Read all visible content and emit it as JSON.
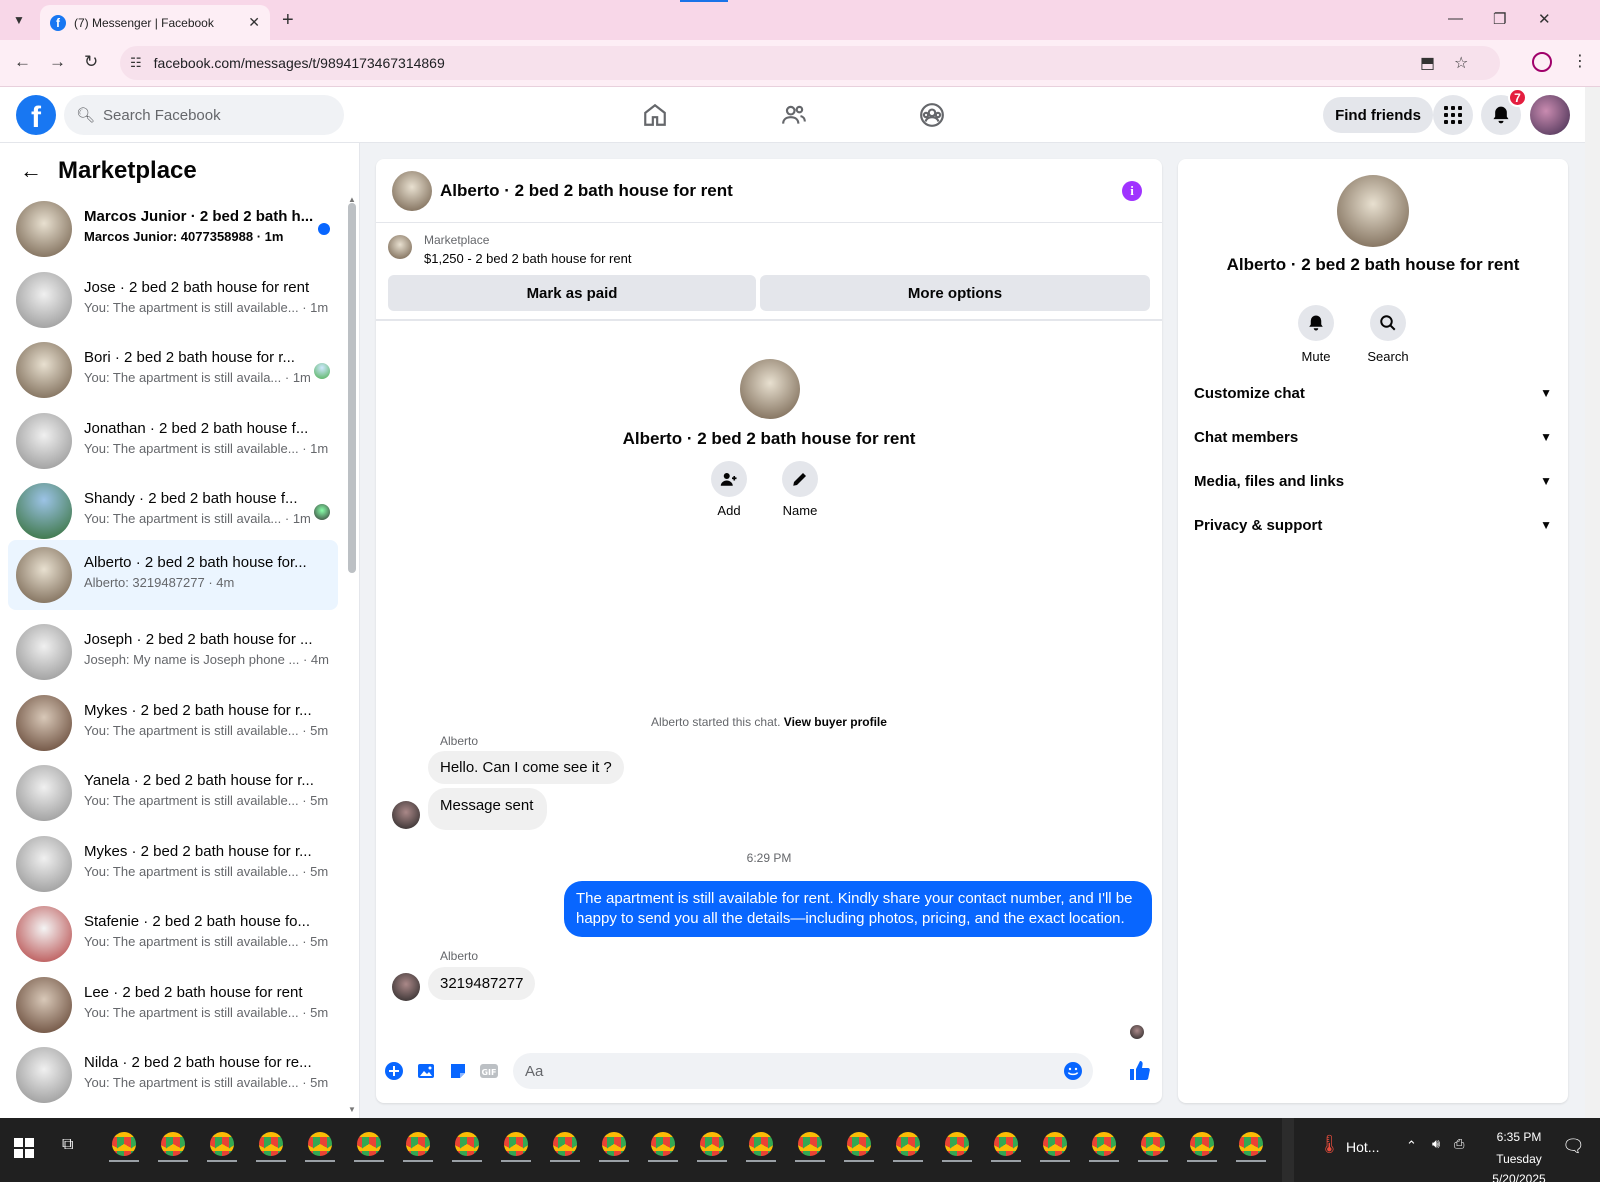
{
  "browser": {
    "tab_title": "(7) Messenger | Facebook",
    "url": "facebook.com/messages/t/9894173467314869"
  },
  "fbnav": {
    "search_placeholder": "Search Facebook",
    "find_friends": "Find friends",
    "notification_count": "7"
  },
  "left": {
    "title": "Marketplace",
    "conversations": [
      {
        "name": "Marcos Junior · 2 bed 2 bath h...",
        "preview": "Marcos Junior: 4077358988 · 1m",
        "unread": true
      },
      {
        "name": "Jose · 2 bed 2 bath house for rent",
        "preview": "You: The apartment is still available... · 1m"
      },
      {
        "name": "Bori · 2 bed 2 bath house for r...",
        "preview": "You: The apartment is still availa... · 1m"
      },
      {
        "name": "Jonathan · 2 bed 2 bath house f...",
        "preview": "You: The apartment is still available... · 1m"
      },
      {
        "name": "Shandy · 2 bed 2 bath house f...",
        "preview": "You: The apartment is still availa... · 1m"
      },
      {
        "name": "Alberto · 2 bed 2 bath house for...",
        "preview": "Alberto: 3219487277 · 4m",
        "active": true
      },
      {
        "name": "Joseph · 2 bed 2 bath house for ...",
        "preview": "Joseph: My name is Joseph phone ... · 4m"
      },
      {
        "name": "Mykes · 2 bed 2 bath house for r...",
        "preview": "You: The apartment is still available... · 5m"
      },
      {
        "name": "Yanela · 2 bed 2 bath house for r...",
        "preview": "You: The apartment is still available... · 5m"
      },
      {
        "name": "Mykes · 2 bed 2 bath house for r...",
        "preview": "You: The apartment is still available... · 5m"
      },
      {
        "name": "Stafenie · 2 bed 2 bath house fo...",
        "preview": "You: The apartment is still available... · 5m"
      },
      {
        "name": "Lee · 2 bed 2 bath house for rent",
        "preview": "You: The apartment is still available... · 5m"
      },
      {
        "name": "Nilda · 2 bed 2 bath house for re...",
        "preview": "You: The apartment is still available... · 5m"
      }
    ]
  },
  "chat": {
    "title": "Alberto · 2 bed 2 bath house for rent",
    "marketplace_label": "Marketplace",
    "listing": "$1,250 - 2 bed 2 bath house for rent",
    "mark_as_paid": "Mark as paid",
    "more_options": "More options",
    "center_name": "Alberto · 2 bed 2 bath house for rent",
    "add_label": "Add",
    "name_label": "Name",
    "started_text": "Alberto started this chat.",
    "view_buyer_profile": "View buyer profile",
    "sender1": "Alberto",
    "msg1": "Hello. Can I come see it ?",
    "msg2": "Message sent",
    "timestamp": "6:29 PM",
    "msg_out": "The apartment is still available for rent. Kindly share your contact number, and I'll be happy to send you all the details—including photos, pricing, and the exact location.",
    "sender2": "Alberto",
    "msg3": "3219487277",
    "composer_placeholder": "Aa"
  },
  "right": {
    "name": "Alberto · 2 bed 2 bath house for rent",
    "mute": "Mute",
    "search": "Search",
    "sections": [
      "Customize chat",
      "Chat members",
      "Media, files and links",
      "Privacy & support"
    ]
  },
  "taskbar": {
    "weather": "Hot...",
    "time": "6:35 PM",
    "day": "Tuesday",
    "date": "5/20/2025"
  },
  "colors": {
    "fb_blue": "#1877f2",
    "messenger_blue": "#0866ff",
    "active_row": "#ebf5ff",
    "info_purple": "#a033ff"
  }
}
